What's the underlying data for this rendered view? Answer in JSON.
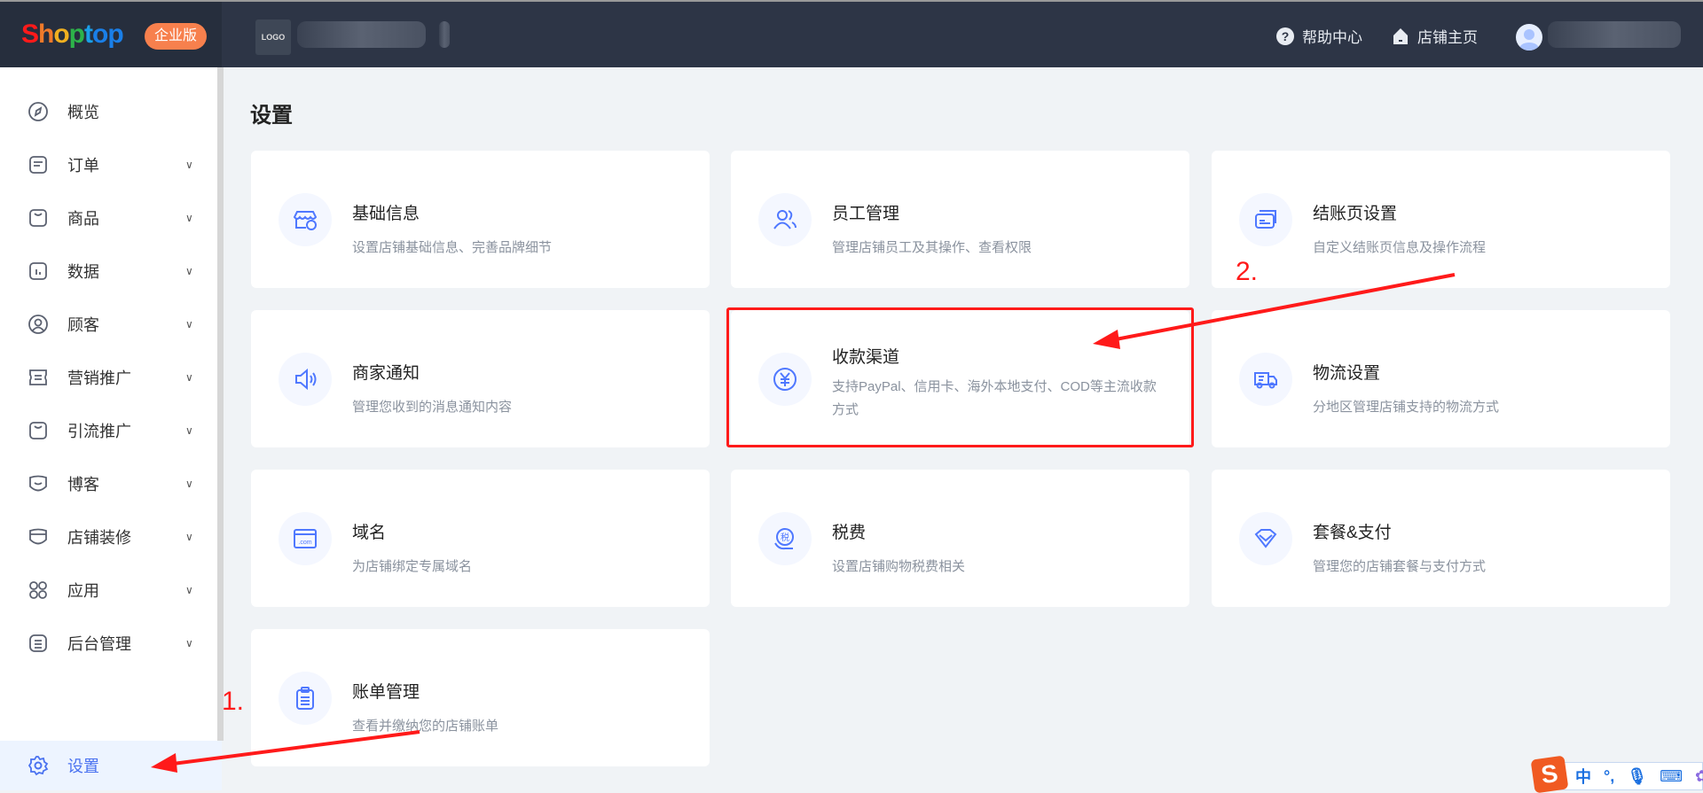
{
  "header": {
    "brand": "Shoptop",
    "edition_badge": "企业版",
    "store_logo": "LOGO",
    "help_label": "帮助中心",
    "store_home_label": "店铺主页",
    "brand_colors": [
      "#ff1a1a",
      "#f0a020",
      "#2db34a",
      "#1a7fe8"
    ]
  },
  "sidebar": {
    "items": [
      {
        "label": "概览",
        "icon": "compass-icon",
        "expandable": false
      },
      {
        "label": "订单",
        "icon": "order-icon",
        "expandable": true
      },
      {
        "label": "商品",
        "icon": "bag-icon",
        "expandable": true
      },
      {
        "label": "数据",
        "icon": "chart-icon",
        "expandable": true
      },
      {
        "label": "顾客",
        "icon": "user-icon",
        "expandable": true
      },
      {
        "label": "营销推广",
        "icon": "ticket-icon",
        "expandable": true
      },
      {
        "label": "引流推广",
        "icon": "bag-icon",
        "expandable": true
      },
      {
        "label": "博客",
        "icon": "blog-icon",
        "expandable": true
      },
      {
        "label": "店铺装修",
        "icon": "decor-icon",
        "expandable": true
      },
      {
        "label": "应用",
        "icon": "apps-icon",
        "expandable": true
      },
      {
        "label": "后台管理",
        "icon": "list-icon",
        "expandable": true
      }
    ],
    "settings_label": "设置",
    "active_color": "#4a72f0"
  },
  "main": {
    "title": "设置",
    "cards": [
      {
        "title": "基础信息",
        "desc": "设置店铺基础信息、完善品牌细节",
        "icon": "store-info-icon"
      },
      {
        "title": "员工管理",
        "desc": "管理店铺员工及其操作、查看权限",
        "icon": "users-icon"
      },
      {
        "title": "结账页设置",
        "desc": "自定义结账页信息及操作流程",
        "icon": "card-icon"
      },
      {
        "title": "商家通知",
        "desc": "管理您收到的消息通知内容",
        "icon": "speaker-icon"
      },
      {
        "title": "收款渠道",
        "desc": "支持PayPal、信用卡、海外本地支付、COD等主流收款方式",
        "icon": "yen-icon"
      },
      {
        "title": "物流设置",
        "desc": "分地区管理店铺支持的物流方式",
        "icon": "truck-icon"
      },
      {
        "title": "域名",
        "desc": "为店铺绑定专属域名",
        "icon": "domain-icon"
      },
      {
        "title": "税费",
        "desc": "设置店铺购物税费相关",
        "icon": "tax-icon"
      },
      {
        "title": "套餐&支付",
        "desc": "管理您的店铺套餐与支付方式",
        "icon": "diamond-icon"
      },
      {
        "title": "账单管理",
        "desc": "查看并缴纳您的店铺账单",
        "icon": "clipboard-icon"
      }
    ]
  },
  "annotations": {
    "step1": "1.",
    "step2": "2.",
    "color": "#ff1a1a"
  },
  "ime": {
    "logo": "S",
    "mode": "中",
    "punct": "°,"
  }
}
